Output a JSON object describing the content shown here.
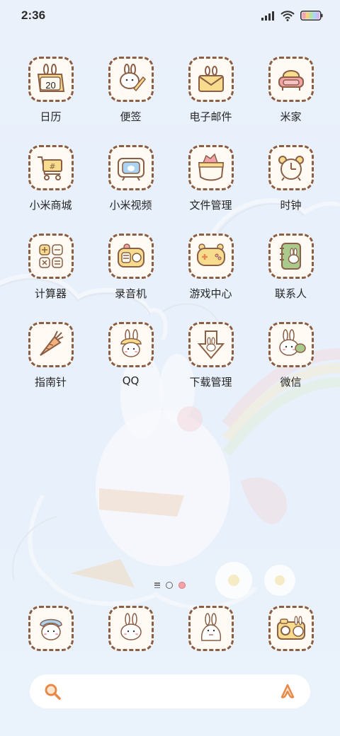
{
  "status_bar": {
    "time": "2:36",
    "icons": [
      "signal-icon",
      "wifi-icon",
      "battery-icon"
    ]
  },
  "apps": [
    {
      "label": "日历",
      "icon": "calendar-icon",
      "badge": "20"
    },
    {
      "label": "便签",
      "icon": "notes-icon"
    },
    {
      "label": "电子邮件",
      "icon": "mail-icon"
    },
    {
      "label": "米家",
      "icon": "sofa-icon"
    },
    {
      "label": "小米商城",
      "icon": "shopping-cart-icon"
    },
    {
      "label": "小米视频",
      "icon": "tv-icon"
    },
    {
      "label": "文件管理",
      "icon": "folder-basket-icon"
    },
    {
      "label": "时钟",
      "icon": "alarm-clock-icon"
    },
    {
      "label": "计算器",
      "icon": "calculator-icon"
    },
    {
      "label": "录音机",
      "icon": "recorder-icon"
    },
    {
      "label": "游戏中心",
      "icon": "gamepad-icon"
    },
    {
      "label": "联系人",
      "icon": "contacts-book-icon"
    },
    {
      "label": "指南针",
      "icon": "compass-carrot-icon"
    },
    {
      "label": "QQ",
      "icon": "bunny-hat-icon"
    },
    {
      "label": "下载管理",
      "icon": "download-arrow-icon"
    },
    {
      "label": "微信",
      "icon": "bunny-chat-icon"
    }
  ],
  "dock": [
    {
      "icon": "phone-bunny-icon"
    },
    {
      "icon": "message-bunny-icon"
    },
    {
      "icon": "browser-bunny-icon"
    },
    {
      "icon": "camera-bunny-icon"
    }
  ],
  "page_indicator": {
    "pages": 2,
    "current": 2
  },
  "search": {
    "icon": "search-icon",
    "assistant_icon": "assistant-icon"
  },
  "colors": {
    "outline": "#8b5e46",
    "icon_bg": "#fffaf3",
    "accent_yellow": "#f6dc8c",
    "accent_pink": "#f3a2a8",
    "search_orange": "#e8894a"
  }
}
